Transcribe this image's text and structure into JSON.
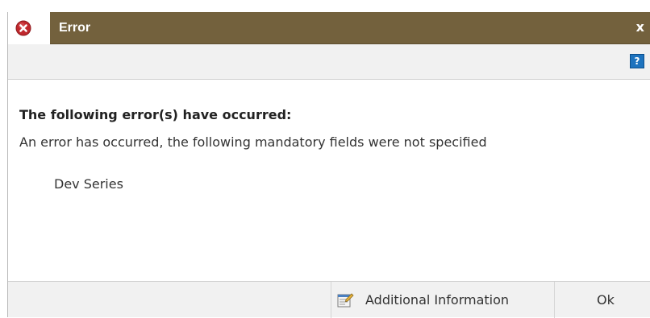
{
  "dialog": {
    "title": "Error",
    "close_label": "x",
    "help_label": "?",
    "colors": {
      "title_bar": "#73613d",
      "title_text": "#ffffff",
      "help_button": "#1e73be",
      "error_icon": "#c0282d"
    },
    "icons": {
      "title": "error-icon",
      "help": "help-icon",
      "info": "document-edit-icon"
    }
  },
  "content": {
    "heading": "The following error(s) have occurred:",
    "message": "An error has occurred, the following mandatory fields were not specified",
    "missing_fields": [
      "Dev Series"
    ]
  },
  "footer": {
    "info_button_label": "Additional Information",
    "ok_button_label": "Ok"
  }
}
